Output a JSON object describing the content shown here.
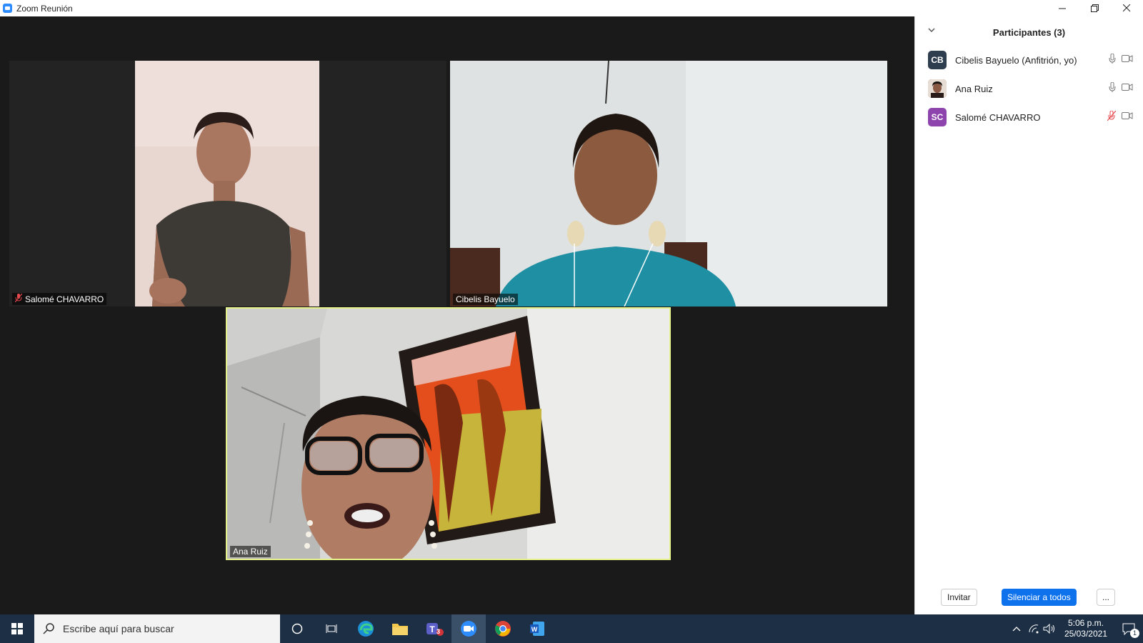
{
  "window": {
    "title": "Zoom Reunión"
  },
  "videos": [
    {
      "name": "Salomé CHAVARRO",
      "muted": true
    },
    {
      "name": "Cibelis Bayuelo",
      "muted": false
    },
    {
      "name": "Ana Ruiz",
      "muted": false,
      "active_speaker": true
    }
  ],
  "panel": {
    "title": "Participantes (3)",
    "participants": [
      {
        "initials": "CB",
        "name": "Cibelis Bayuelo (Anfitrión, yo)",
        "avatar_color": "#2f3e4e",
        "muted": false,
        "avatar_type": "initials"
      },
      {
        "initials": "",
        "name": "Ana Ruiz",
        "avatar_color": "#5a3a2a",
        "muted": false,
        "avatar_type": "photo"
      },
      {
        "initials": "SC",
        "name": "Salomé CHAVARRO",
        "avatar_color": "#8e44ad",
        "muted": true,
        "avatar_type": "initials"
      }
    ],
    "buttons": {
      "invite": "Invitar",
      "mute_all": "Silenciar a todos",
      "more": "..."
    }
  },
  "taskbar": {
    "search_placeholder": "Escribe aquí para buscar",
    "teams_badge": "3",
    "time": "5:06 p.m.",
    "date": "25/03/2021",
    "notification_count": "1"
  },
  "colors": {
    "accent": "#0e72ed",
    "active_speaker_border": "#e5f28a",
    "muted_red": "#e5484d",
    "taskbar": "#1c2f44"
  }
}
